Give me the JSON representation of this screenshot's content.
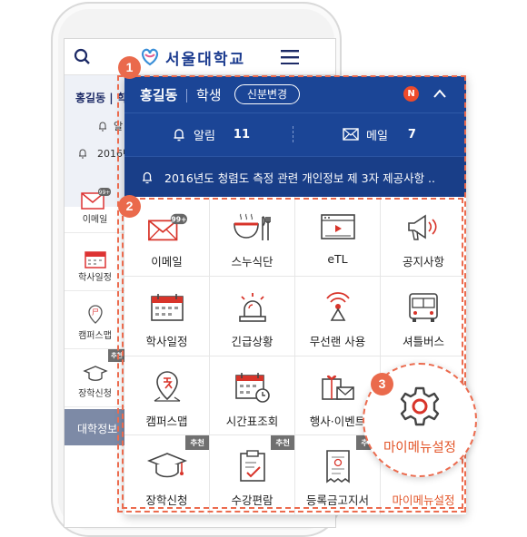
{
  "background_phone": {
    "logo_text": "서울대학교",
    "user_name": "홍길동",
    "user_role": "학",
    "date_text": "2016년",
    "list_items": [
      {
        "label": "이메일",
        "badge": "99+"
      },
      {
        "label": "학사일정"
      },
      {
        "label": "캠퍼스맵"
      },
      {
        "label": "장학신청",
        "tag": "추천"
      }
    ],
    "info_bar": "대학정보"
  },
  "panel": {
    "user_name": "홍길동",
    "user_role": "학생",
    "change_button": "신분변경",
    "new_badge": "N",
    "alerts_label": "알림",
    "alerts_count": "11",
    "mail_label": "메일",
    "mail_count": "7",
    "notice": "2016년도 청렴도 측정 관련 개인정보 제 3자 제공사항 ..",
    "grid": [
      {
        "label": "이메일",
        "icon": "mail-icon",
        "badge": "99+"
      },
      {
        "label": "스누식단",
        "icon": "dining-icon"
      },
      {
        "label": "eTL",
        "icon": "video-player-icon"
      },
      {
        "label": "공지사항",
        "icon": "megaphone-icon"
      },
      {
        "label": "학사일정",
        "icon": "calendar-icon"
      },
      {
        "label": "긴급상황",
        "icon": "siren-icon"
      },
      {
        "label": "무선랜 사용",
        "icon": "wifi-signal-icon"
      },
      {
        "label": "셔틀버스",
        "icon": "bus-icon"
      },
      {
        "label": "캠퍼스맵",
        "icon": "map-pin-icon"
      },
      {
        "label": "시간표조회",
        "icon": "timetable-icon"
      },
      {
        "label": "행사·이벤트",
        "icon": "gift-mail-icon"
      },
      {
        "label": "",
        "icon": "blank"
      },
      {
        "label": "장학신청",
        "icon": "graduation-cap-icon",
        "tag": "추천"
      },
      {
        "label": "수강편람",
        "icon": "checklist-icon",
        "tag": "추천"
      },
      {
        "label": "등록금고지서",
        "icon": "receipt-icon",
        "tag": "추천"
      },
      {
        "label": "마이메뉴설정",
        "icon": "gear-icon"
      }
    ]
  },
  "annotations": {
    "badge1": "1",
    "badge2": "2",
    "badge3": "3",
    "zoom_label": "마이메뉴설정"
  },
  "colors": {
    "header_blue": "#1b4596",
    "accent_orange": "#ea6a4c",
    "new_badge_red": "#ee4b2b"
  }
}
